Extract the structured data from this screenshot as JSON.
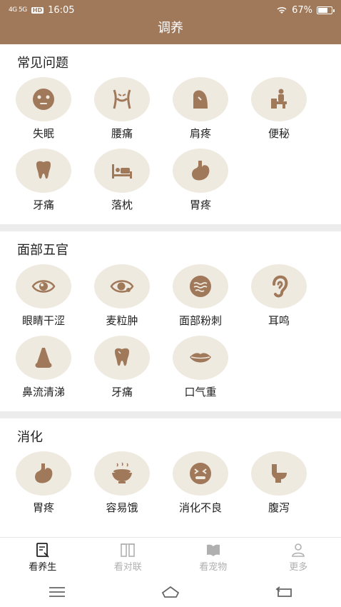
{
  "status": {
    "network": "4G  5G",
    "hd": "HD",
    "time": "16:05",
    "battery": "67%",
    "battery_level": 0.67
  },
  "header": {
    "title": "调养"
  },
  "sections": [
    {
      "title": "常见问题",
      "items": [
        {
          "label": "失眠",
          "icon": "face-mask-icon"
        },
        {
          "label": "腰痛",
          "icon": "waist-icon"
        },
        {
          "label": "肩疼",
          "icon": "shoulder-icon"
        },
        {
          "label": "便秘",
          "icon": "toilet-person-icon"
        },
        {
          "label": "牙痛",
          "icon": "tooth-icon"
        },
        {
          "label": "落枕",
          "icon": "bed-icon"
        },
        {
          "label": "胃疼",
          "icon": "stomach-icon"
        }
      ]
    },
    {
      "title": "面部五官",
      "items": [
        {
          "label": "眼睛干涩",
          "icon": "eye-icon"
        },
        {
          "label": "麦粒肿",
          "icon": "eye-swelling-icon"
        },
        {
          "label": "面部粉刺",
          "icon": "face-acne-icon"
        },
        {
          "label": "耳鸣",
          "icon": "ear-icon"
        },
        {
          "label": "鼻流清涕",
          "icon": "nose-icon"
        },
        {
          "label": "牙痛",
          "icon": "tooth-icon"
        },
        {
          "label": "口气重",
          "icon": "lips-icon"
        }
      ]
    },
    {
      "title": "消化",
      "items": [
        {
          "label": "胃疼",
          "icon": "stomach-icon"
        },
        {
          "label": "容易饿",
          "icon": "food-bowl-icon"
        },
        {
          "label": "消化不良",
          "icon": "nauseous-face-icon"
        },
        {
          "label": "腹泻",
          "icon": "toilet-icon"
        }
      ]
    }
  ],
  "tabs": [
    {
      "label": "看养生",
      "active": true
    },
    {
      "label": "看对联",
      "active": false
    },
    {
      "label": "看宠物",
      "active": false
    },
    {
      "label": "更多",
      "active": false
    }
  ],
  "colors": {
    "accent": "#a0785a",
    "icon": "#a0785a",
    "circle": "#efeae0"
  }
}
